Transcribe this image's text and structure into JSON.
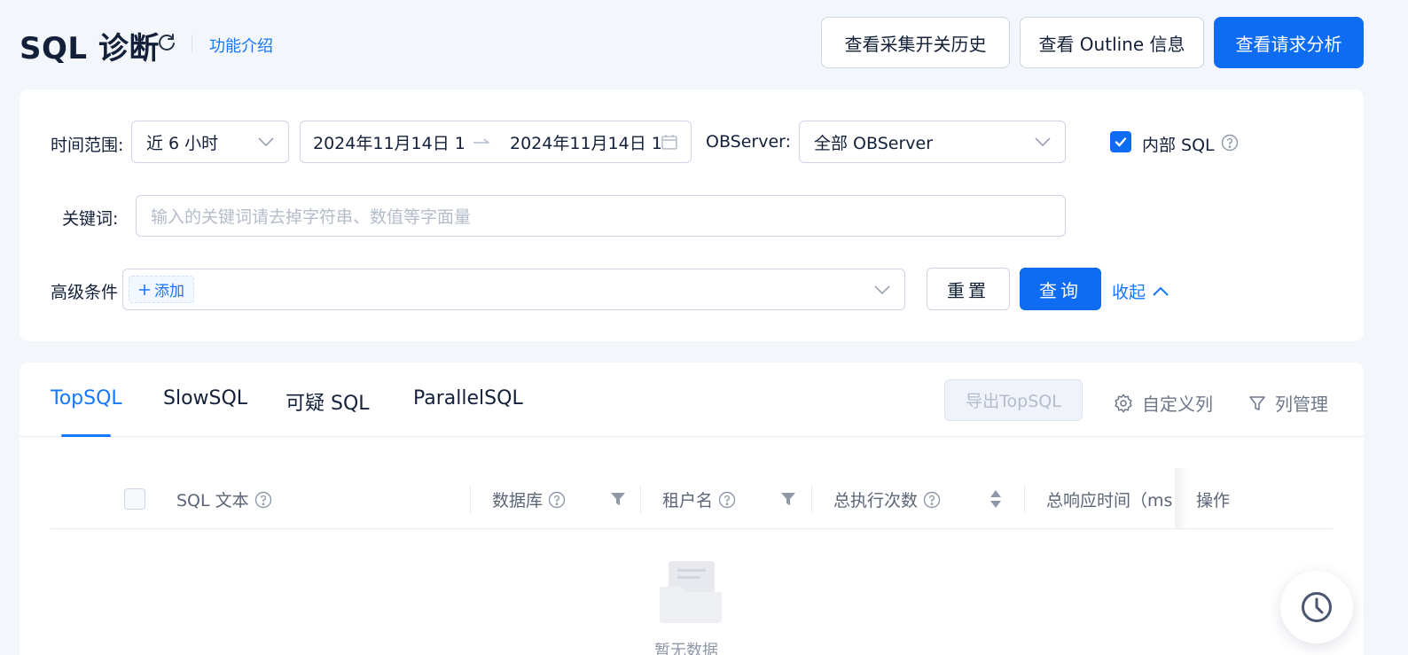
{
  "header": {
    "title": "SQL 诊断",
    "intro_link": "功能介绍",
    "buttons": {
      "history": "查看采集开关历史",
      "outline": "查看 Outline 信息",
      "request": "查看请求分析"
    }
  },
  "filters": {
    "time_range_label": "时间范围:",
    "time_range_value": "近 6 小时",
    "date_start": "2024年11月14日 1",
    "date_end": "2024年11月14日 1",
    "observer_label": "OBServer:",
    "observer_value": "全部 OBServer",
    "internal_sql_label": "内部 SQL",
    "internal_sql_checked": true,
    "keyword_label": "关键词:",
    "keyword_placeholder": "输入的关键词请去掉字符串、数值等字面量",
    "advanced_label": "高级条件",
    "add_label": "添加",
    "reset_label": "重置",
    "query_label": "查询",
    "collapse_label": "收起"
  },
  "tabs": [
    {
      "label": "TopSQL",
      "active": true
    },
    {
      "label": "SlowSQL",
      "active": false
    },
    {
      "label": "可疑 SQL",
      "active": false
    },
    {
      "label": "ParallelSQL",
      "active": false
    }
  ],
  "toolbar": {
    "export_label": "导出TopSQL",
    "custom_columns_label": "自定义列",
    "column_manage_label": "列管理"
  },
  "table": {
    "columns": [
      "SQL 文本",
      "数据库",
      "租户名",
      "总执行次数",
      "总响应时间（ms",
      "操作"
    ]
  },
  "empty": {
    "text": "暂无数据"
  },
  "colors": {
    "primary": "#0d6cf2",
    "link": "#1677ff",
    "background": "#f3f6fb"
  }
}
